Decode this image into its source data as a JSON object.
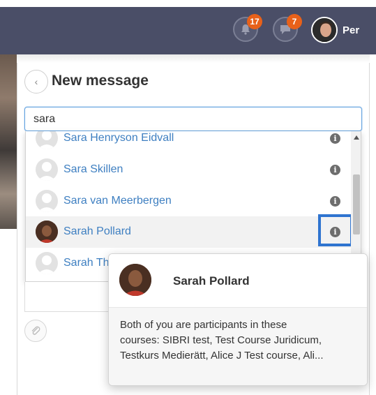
{
  "header": {
    "username": "Per",
    "notifications_count": "17",
    "messages_count": "7",
    "notifications_icon": "bell-icon",
    "messages_icon": "chat-bubble-icon"
  },
  "panel": {
    "title": "New message",
    "back_icon": "chevron-left-icon"
  },
  "search": {
    "value": "sara"
  },
  "results": [
    {
      "name": "Sara Henryson Eidvall"
    },
    {
      "name": "Sara Skillen"
    },
    {
      "name": "Sara van Meerbergen"
    },
    {
      "name": "Sarah Pollard"
    },
    {
      "name": "Sarah Th"
    }
  ],
  "popover": {
    "name": "Sarah Pollard",
    "lines": [
      "Both of you are participants in these",
      "courses: SIBRI test, Test Course Juridicum,",
      "Testkurs Medierätt, Alice J Test course, Ali..."
    ]
  },
  "colors": {
    "navbar": "#4a4e67",
    "badge": "#e8611a",
    "link": "#3e7fc1",
    "highlight": "#2f74d0"
  }
}
